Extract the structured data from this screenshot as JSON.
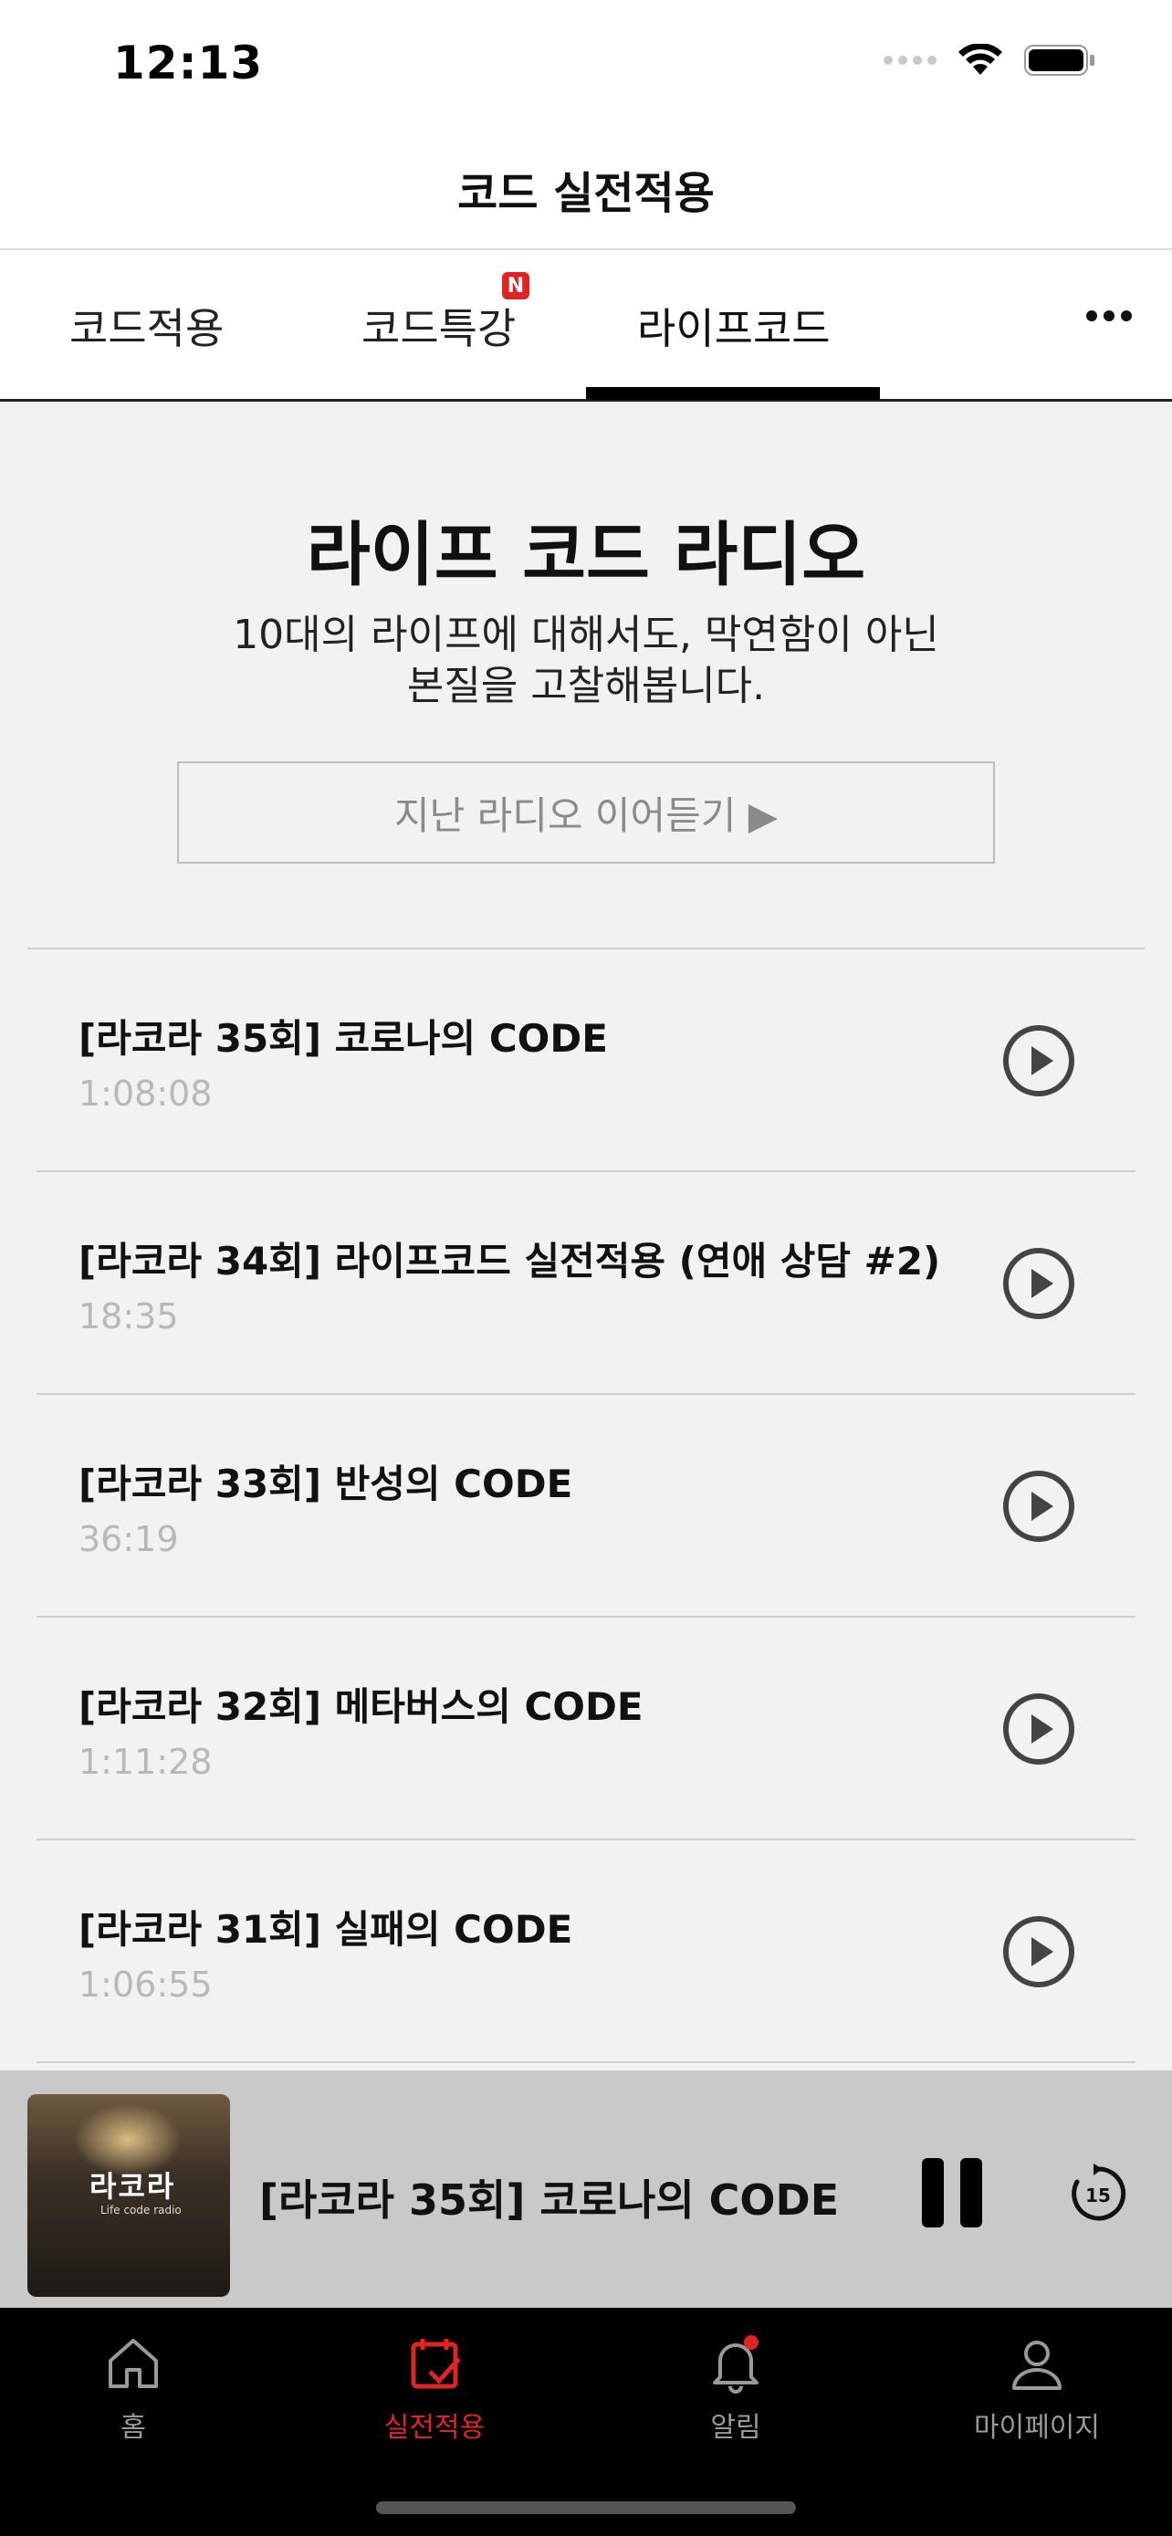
{
  "status_bar": {
    "time": "12:13"
  },
  "nav": {
    "title": "코드 실전적용"
  },
  "tabs": {
    "items": [
      {
        "label": "코드적용"
      },
      {
        "label": "코드특강",
        "badge": "N"
      },
      {
        "label": "라이프코드"
      }
    ],
    "selected": "라이프코드"
  },
  "hero": {
    "title": "라이프 코드 라디오",
    "desc_line1": "10대의 라이프에 대해서도, 막연함이 아닌",
    "desc_line2": "본질을 고찰해봅니다.",
    "prev_button": "지난 라디오 이어듣기 ▶"
  },
  "episodes": [
    {
      "title": "[라코라 35회] 코로나의 CODE",
      "duration": "1:08:08"
    },
    {
      "title": "[라코라 34회] 라이프코드 실전적용  (연애 상담 #2)",
      "duration": "18:35"
    },
    {
      "title": "[라코라 33회] 반성의 CODE",
      "duration": "36:19"
    },
    {
      "title": "[라코라 32회] 메타버스의 CODE",
      "duration": "1:11:28"
    },
    {
      "title": "[라코라 31회] 실패의 CODE",
      "duration": "1:06:55"
    }
  ],
  "player": {
    "art_logo": "라코라",
    "art_sub": "Life code radio",
    "title": "[라코라 35회] 코로나의 CODE",
    "skip_seconds": "15"
  },
  "tab_bar": {
    "items": [
      {
        "label": "홈",
        "icon": "home-icon"
      },
      {
        "label": "실전적용",
        "icon": "calendar-check-icon"
      },
      {
        "label": "알림",
        "icon": "bell-icon"
      },
      {
        "label": "마이페이지",
        "icon": "person-icon"
      }
    ],
    "active": "실전적용"
  },
  "colors": {
    "accent": "#e02424",
    "background": "#f2f2f2",
    "player_bg": "#c9c9c9",
    "tab_bar_bg": "#000000"
  }
}
